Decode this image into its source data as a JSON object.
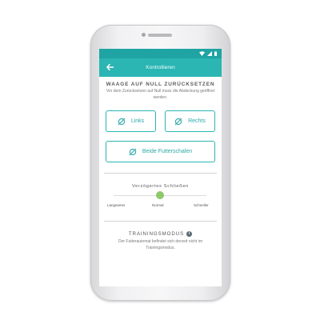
{
  "app": {
    "title": "Kontrollieren"
  },
  "colors": {
    "accent": "#2bb5b3",
    "statusbar": "#1fa3a3",
    "slider_thumb": "#8dc96a"
  },
  "icons": {
    "back": "arrow-left-icon",
    "zero": "slashed-zero-icon",
    "info": "info-icon"
  },
  "zero_section": {
    "title": "WAAGE AUF NULL ZURÜCKSETZEN",
    "description": "Vor dem Zurücksetzen auf Null muss die Abdeckung geöffnet werden.",
    "buttons": {
      "left": "Links",
      "right": "Rechts",
      "both": "Beide Futterschalen"
    }
  },
  "delay_section": {
    "title": "Verzögertes Schließen",
    "labels": {
      "slow": "Langsamer",
      "normal": "Normal",
      "fast": "Schneller"
    },
    "selected": "Normal"
  },
  "training_section": {
    "title": "TRAININGSMODUS",
    "description": "Der Futterautomat befindet sich derzeit nicht im Trainingsmodus."
  }
}
